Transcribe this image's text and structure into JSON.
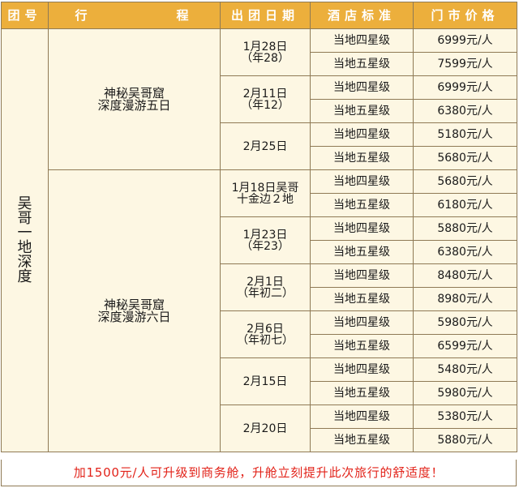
{
  "header": {
    "col_group": "团号",
    "col_route_left": "行",
    "col_route_right": "程",
    "col_date": "出团日期",
    "col_hotel": "酒店标准",
    "col_price": "门市价格"
  },
  "group_name": "吴\n哥\n一\n地\n深\n度",
  "routes": [
    {
      "name": "神秘吴哥窟\n深度漫游五日"
    },
    {
      "name": "神秘吴哥窟\n深度漫游六日"
    }
  ],
  "dates": [
    {
      "label": "1月28日\n（年28）",
      "options": [
        {
          "hotel": "当地四星级",
          "price": "6999元/人"
        },
        {
          "hotel": "当地五星级",
          "price": "7599元/人"
        }
      ]
    },
    {
      "label": "2月11日\n（年12）",
      "options": [
        {
          "hotel": "当地四星级",
          "price": "6999元/人"
        },
        {
          "hotel": "当地五星级",
          "price": "6380元/人"
        }
      ]
    },
    {
      "label": "2月25日",
      "options": [
        {
          "hotel": "当地四星级",
          "price": "5180元/人"
        },
        {
          "hotel": "当地五星级",
          "price": "5680元/人"
        }
      ]
    },
    {
      "label": "1月18日吴哥\n十金边２地",
      "options": [
        {
          "hotel": "当地四星级",
          "price": "5680元/人"
        },
        {
          "hotel": "当地五星级",
          "price": "6180元/人"
        }
      ]
    },
    {
      "label": "1月23日\n（年23）",
      "options": [
        {
          "hotel": "当地四星级",
          "price": "5880元/人"
        },
        {
          "hotel": "当地五星级",
          "price": "6380元/人"
        }
      ]
    },
    {
      "label": "2月1日\n（年初二）",
      "options": [
        {
          "hotel": "当地四星级",
          "price": "8480元/人"
        },
        {
          "hotel": "当地五星级",
          "price": "8980元/人"
        }
      ]
    },
    {
      "label": "2月6日\n（年初七）",
      "options": [
        {
          "hotel": "当地四星级",
          "price": "5980元/人"
        },
        {
          "hotel": "当地五星级",
          "price": "6599元/人"
        }
      ]
    },
    {
      "label": "2月15日",
      "options": [
        {
          "hotel": "当地四星级",
          "price": "5480元/人"
        },
        {
          "hotel": "当地五星级",
          "price": "5980元/人"
        }
      ]
    },
    {
      "label": "2月20日",
      "options": [
        {
          "hotel": "当地四星级",
          "price": "5380元/人"
        },
        {
          "hotel": "当地五星级",
          "price": "5880元/人"
        }
      ]
    }
  ],
  "footnote": "加1500元/人可升级到商务舱，升舱立刻提升此次旅行的舒适度！",
  "colors": {
    "header_bg": "#ecaf3c",
    "cell_bg": "#fdf7e3",
    "border": "#8f7a55",
    "footnote_text": "#e2231a"
  }
}
